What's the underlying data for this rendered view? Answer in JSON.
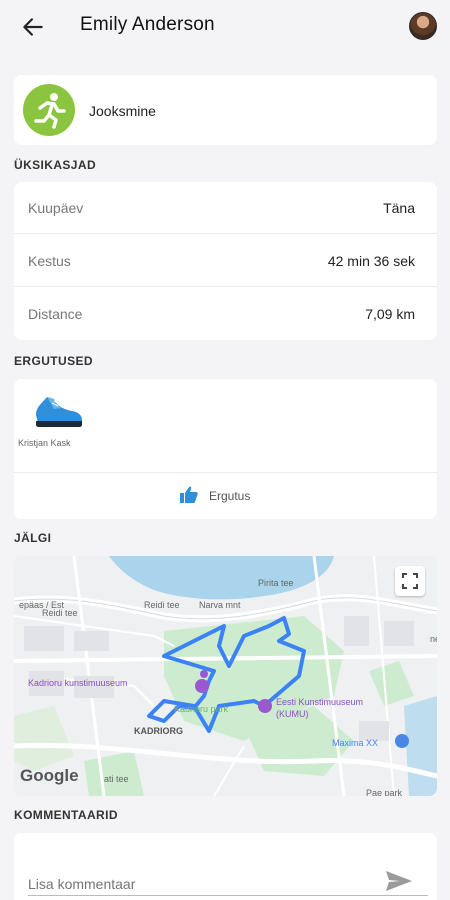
{
  "header": {
    "title": "Emily Anderson"
  },
  "activity": {
    "label": "Jooksmine"
  },
  "sections": {
    "details": "ÜKSIKASJAD",
    "kudos": "ERGUTUSED",
    "track": "JÄLGI",
    "comments": "KOMMENTAARID"
  },
  "details": [
    {
      "key": "Kuupäev",
      "value": "Täna"
    },
    {
      "key": "Kestus",
      "value": "42 min 36 sek"
    },
    {
      "key": "Distance",
      "value": "7,09 km"
    }
  ],
  "kudos": {
    "giver": "Kristjan Kask",
    "button_label": "Ergutus"
  },
  "map": {
    "labels": {
      "kadriorg_museum": "Kadrioru kunstimuuseum",
      "kadriorg": "KADRIORG",
      "kumu": "Eesti Kunstimuuseum",
      "kumu_short": "(KUMU)",
      "maxima": "Maxima XX",
      "park": "Kadrioru park",
      "narva": "Narva mnt",
      "petrool": "Pirita tee",
      "reidi": "Reidi tee",
      "pae": "Pae park",
      "google": "Google",
      "lepas": "epäas / Est",
      "alt": "ati tee",
      "ne": "ne"
    }
  },
  "comment": {
    "placeholder": "Lisa kommentaar"
  },
  "colors": {
    "accent_green": "#8bc53f",
    "route_blue": "#3b82f6",
    "map_water": "#a9d4ec",
    "map_park": "#cdeccf"
  },
  "icons": {
    "back": "arrow-left-icon",
    "runner": "running-person-icon",
    "shoe": "sneaker-icon",
    "thumb": "thumbs-up-icon",
    "expand": "fullscreen-icon",
    "send": "send-icon"
  }
}
